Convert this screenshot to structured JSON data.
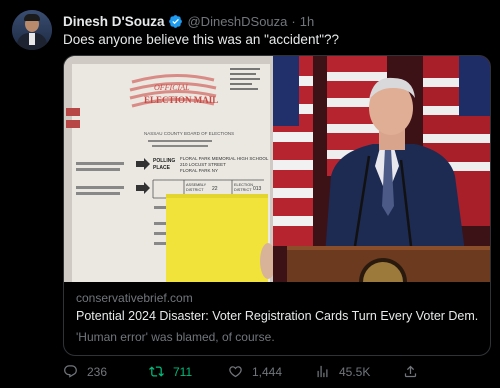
{
  "author": {
    "name": "Dinesh D'Souza",
    "handle": "@DineshDSouza",
    "separator": "·",
    "time": "1h"
  },
  "tweet": {
    "text": "Does anyone believe this was an \"accident\"??"
  },
  "card": {
    "domain": "conservativebrief.com",
    "title": "Potential 2024 Disaster: Voter Registration Cards Turn Every Voter Dem...",
    "description": "'Human error' was blamed, of course.",
    "ballot": {
      "header": "OFFICIAL",
      "header2": "ELECTION MAIL",
      "board": "NASSAU COUNTY BOARD OF ELECTIONS",
      "polling_label": "POLLING PLACE",
      "polling_value": "FLORAL PARK MEMORIAL HIGH SCHOOL",
      "polling_addr": "210 LOCUST STREET",
      "polling_city": "FLORAL PARK NY",
      "district_label": "ASSEMBLY DISTRICT",
      "district_value": "22",
      "election_label": "ELECTION DISTRICT",
      "election_value": "013"
    }
  },
  "actions": {
    "replies": "236",
    "retweets": "711",
    "likes": "1,444",
    "views": "45.5K"
  },
  "colors": {
    "background": "#000000",
    "text": "#e7e9ea",
    "muted": "#71767b",
    "verified": "#1d9bf0",
    "retweet": "#00ba7c",
    "border": "#2f3336"
  }
}
